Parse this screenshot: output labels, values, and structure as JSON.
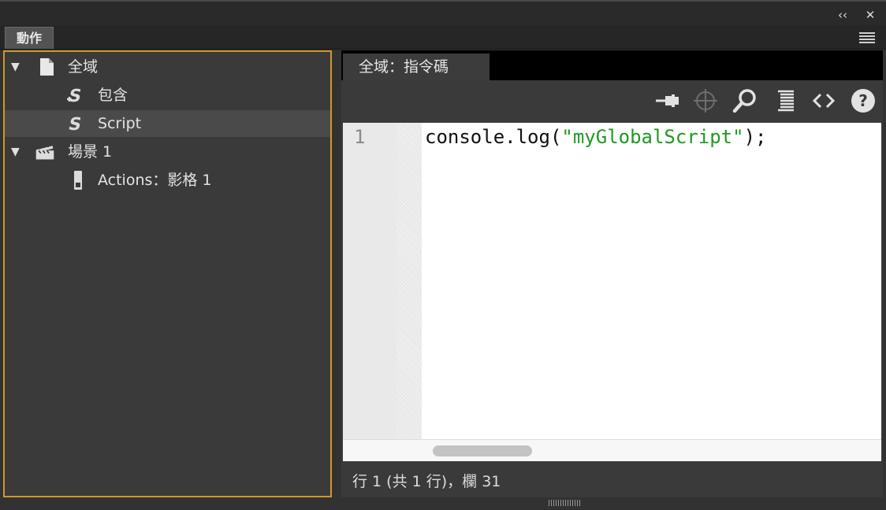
{
  "titlebar": {
    "collapse_icon": "double-chevron-left-icon",
    "close_icon": "close-icon",
    "collapse_glyph": "‹‹",
    "close_glyph": "✕"
  },
  "panel": {
    "tab_label": "動作",
    "menu_icon": "hamburger-menu-icon"
  },
  "tree": {
    "items": [
      {
        "label": "全域",
        "icon": "document-icon",
        "expanded": true,
        "level": 0
      },
      {
        "label": "包含",
        "icon": "script-include-icon",
        "level": 1
      },
      {
        "label": "Script",
        "icon": "script-icon",
        "level": 1,
        "selected": true
      },
      {
        "label": "場景 1",
        "icon": "clapperboard-icon",
        "expanded": true,
        "level": 0
      },
      {
        "label": "Actions：影格 1",
        "icon": "frame-icon",
        "level": 1
      }
    ]
  },
  "editor": {
    "tab_label": "全域：指令碼",
    "toolbar": [
      {
        "name": "pin-icon"
      },
      {
        "name": "crosshair-icon"
      },
      {
        "name": "search-icon"
      },
      {
        "name": "format-code-icon"
      },
      {
        "name": "code-brackets-icon"
      },
      {
        "name": "help-icon"
      }
    ],
    "line_number": "1",
    "code_prefix": "console.log(",
    "code_string": "\"myGlobalScript\"",
    "code_suffix": ");",
    "status": "行 1 (共 1 行)，欄 31"
  },
  "colors": {
    "focus_border": "#d1962b",
    "string": "#1f9a1f"
  }
}
